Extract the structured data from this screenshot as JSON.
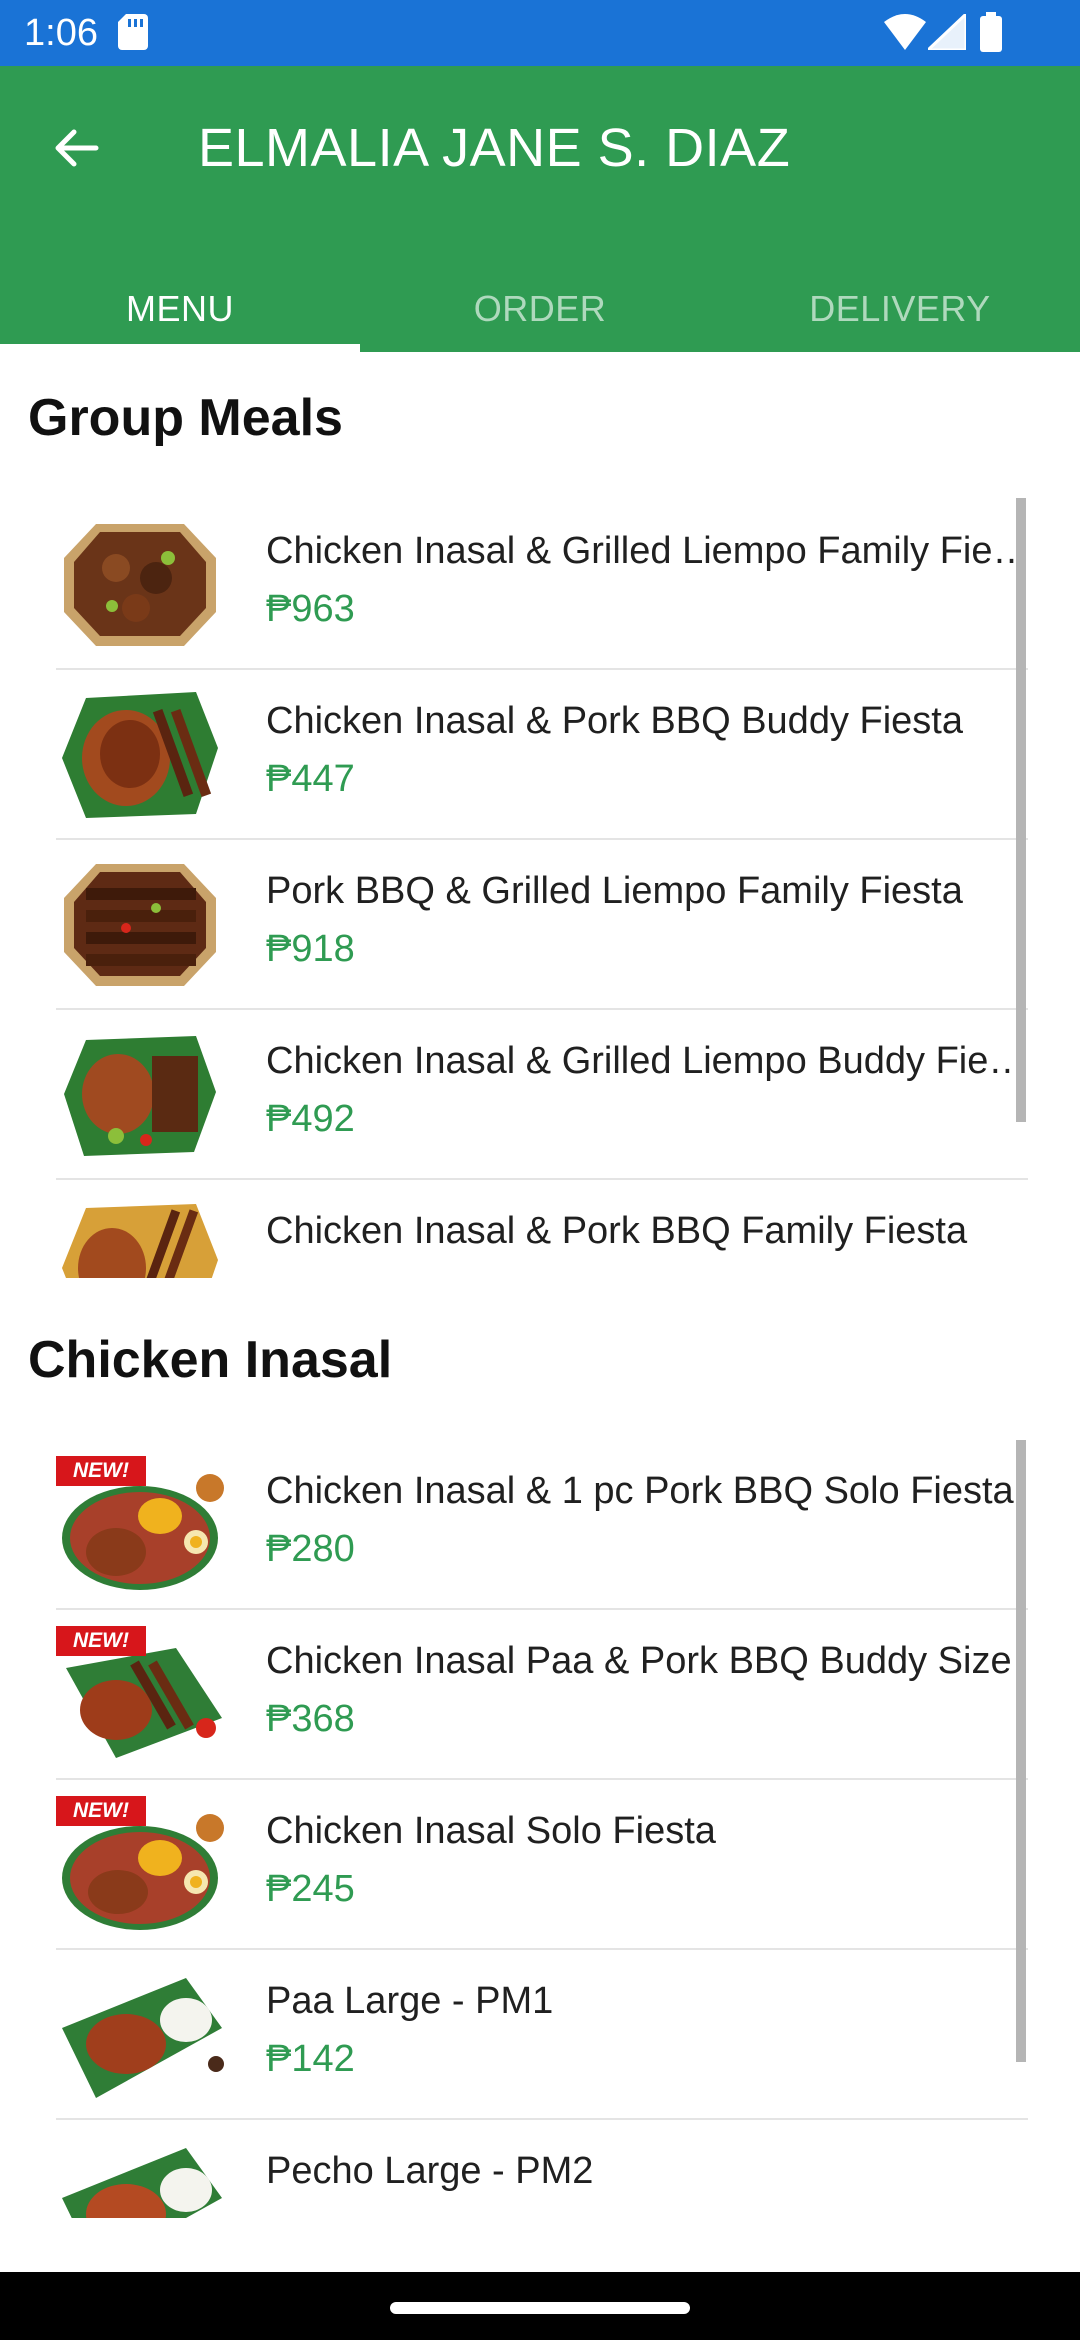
{
  "status_bar": {
    "time": "1:06",
    "icons": [
      "sd-card-icon",
      "wifi-icon",
      "cell-signal-icon",
      "battery-icon"
    ]
  },
  "app_bar": {
    "title": "ELMALIA JANE S. DIAZ",
    "back_icon": "arrow-left-icon"
  },
  "tabs": [
    {
      "label": "MENU",
      "active": true
    },
    {
      "label": "ORDER",
      "active": false
    },
    {
      "label": "DELIVERY",
      "active": false
    }
  ],
  "sections": [
    {
      "title": "Group Meals",
      "items": [
        {
          "name": "Chicken Inasal & Grilled Liempo Family Fie…",
          "price": "₱963",
          "new": false
        },
        {
          "name": "Chicken Inasal & Pork BBQ Buddy Fiesta",
          "price": "₱447",
          "new": false
        },
        {
          "name": "Pork BBQ & Grilled Liempo Family Fiesta",
          "price": "₱918",
          "new": false
        },
        {
          "name": "Chicken Inasal & Grilled Liempo Buddy Fie…",
          "price": "₱492",
          "new": false
        },
        {
          "name": "Chicken Inasal & Pork BBQ Family Fiesta",
          "price": "",
          "new": false
        }
      ]
    },
    {
      "title": "Chicken Inasal",
      "items": [
        {
          "name": "Chicken Inasal & 1 pc Pork BBQ Solo Fiesta",
          "price": "₱280",
          "new": true
        },
        {
          "name": "Chicken Inasal Paa & Pork BBQ Buddy Size",
          "price": "₱368",
          "new": true
        },
        {
          "name": "Chicken Inasal Solo Fiesta",
          "price": "₱245",
          "new": true
        },
        {
          "name": "Paa Large - PM1",
          "price": "₱142",
          "new": false
        },
        {
          "name": "Pecho Large - PM2",
          "price": "",
          "new": false
        }
      ]
    }
  ],
  "badge_text": "NEW!",
  "colors": {
    "status_bar": "#1a73d6",
    "brand_green": "#2f9b52",
    "badge_red": "#d7161b"
  }
}
